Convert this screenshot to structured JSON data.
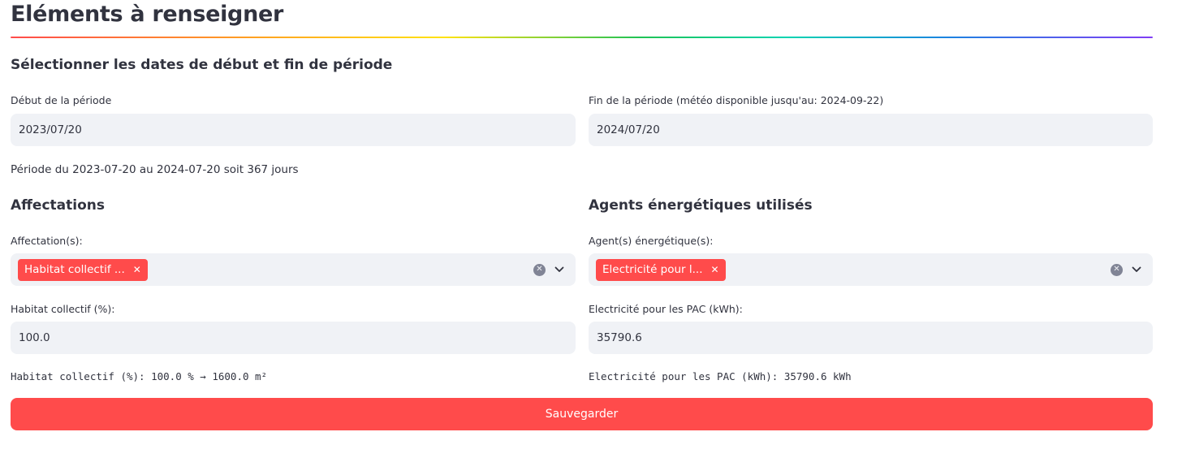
{
  "page": {
    "title": "Eléments à renseigner"
  },
  "period": {
    "subheader": "Sélectionner les dates de début et fin de période",
    "start_label": "Début de la période",
    "start_value": "2023/07/20",
    "end_label": "Fin de la période (météo disponible jusqu'au: 2024-09-22)",
    "end_value": "2024/07/20",
    "summary": "Période du 2023-07-20 au 2024-07-20 soit 367 jours"
  },
  "affectations": {
    "subheader": "Affectations",
    "select_label": "Affectation(s):",
    "tags": [
      "Habitat collectif ..."
    ],
    "field_label": "Habitat collectif (%):",
    "field_value": "100.0",
    "result": "Habitat collectif (%): 100.0 % → 1600.0 m²"
  },
  "agents": {
    "subheader": "Agents énergétiques utilisés",
    "select_label": "Agent(s) énergétique(s):",
    "tags": [
      "Electricité pour l..."
    ],
    "field_label": "Electricité pour les PAC (kWh):",
    "field_value": "35790.6",
    "result": "Electricité pour les PAC (kWh): 35790.6 kWh"
  },
  "actions": {
    "save_label": "Sauvegarder"
  },
  "icons": {
    "tag_remove": "close-icon",
    "clear_all": "clear-circle-icon",
    "dropdown": "chevron-down-icon"
  },
  "colors": {
    "accent": "#ff4b4b",
    "input_bg": "#f0f2f6",
    "text": "#31333f"
  }
}
